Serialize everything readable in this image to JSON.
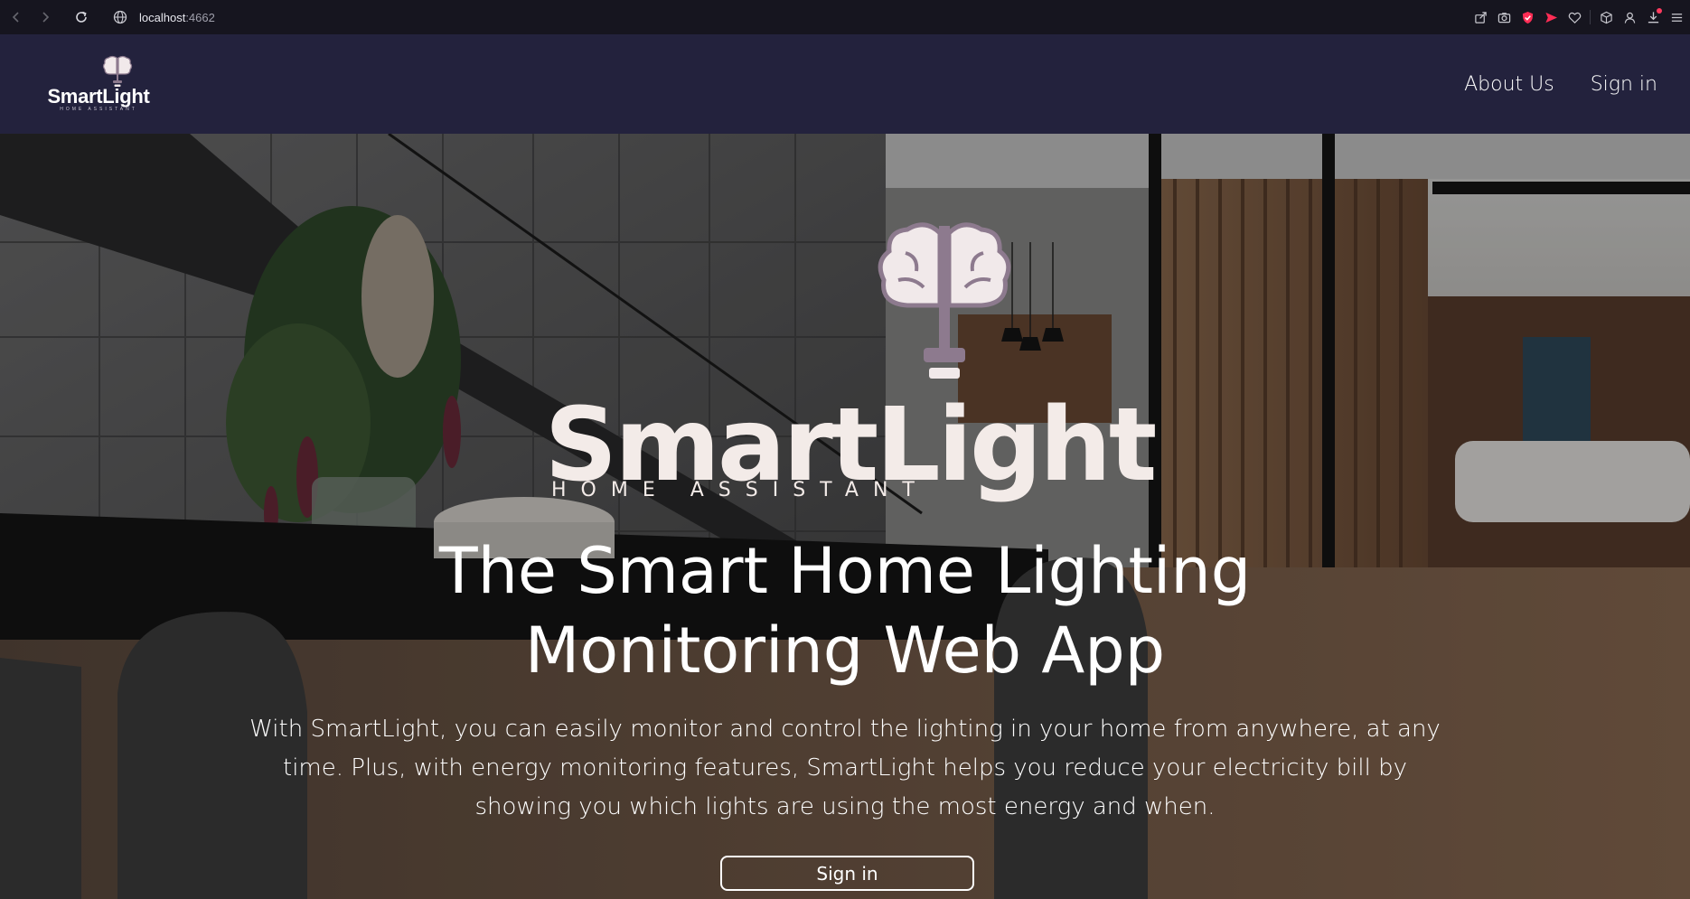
{
  "browser": {
    "url_host": "localhost",
    "url_port": ":4662",
    "icons": [
      "back-icon",
      "forward-icon",
      "reload-icon",
      "site-info-icon",
      "share-icon",
      "screenshot-icon",
      "shield-icon",
      "send-icon",
      "heart-icon",
      "extensions-icon",
      "profile-icon",
      "downloads-icon",
      "menu-icon"
    ]
  },
  "navbar": {
    "brand_name": "SmartLight",
    "brand_tag": "HOME ASSISTANT",
    "links": [
      {
        "label": "About Us"
      },
      {
        "label": "Sign in"
      }
    ]
  },
  "hero": {
    "logo_name": "SmartLight",
    "logo_tag": "HOME ASSISTANT",
    "title_line1": "The Smart Home Lighting",
    "title_line2": "Monitoring Web App",
    "description": "With SmartLight, you can easily monitor and control the lighting in your home from anywhere, at any time. Plus, with energy monitoring features, SmartLight helps you reduce your electricity bill by showing you which lights are using the most energy and when.",
    "cta_label": "Sign in"
  },
  "colors": {
    "navbar_bg": "#23223d",
    "browser_bg": "#16151f",
    "logo_cream": "#f3ebe8",
    "logo_mauve": "#8d7a8e"
  }
}
